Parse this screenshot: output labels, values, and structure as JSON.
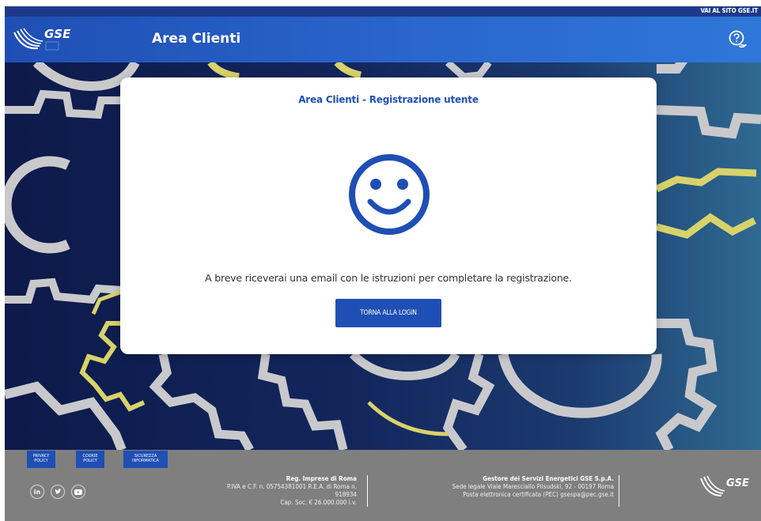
{
  "top_link": "VAI AL SITO GSE.IT",
  "header": {
    "logo_text": "GSE",
    "title": "Area Clienti"
  },
  "card": {
    "title": "Area Clienti - Registrazione utente",
    "message": "A breve riceverai una email con le istruzioni per completare la registrazione.",
    "button": "TORNA ALLA LOGIN"
  },
  "footer": {
    "links": [
      {
        "line1": "PRIVACY",
        "line2": "POLICY"
      },
      {
        "line1": "COOKIE",
        "line2": "POLICY"
      },
      {
        "line1": "SICUREZZA",
        "line2": "INFORMATICA"
      }
    ],
    "social": [
      "in",
      "t",
      "yt"
    ],
    "registry": {
      "heading": "Reg. Imprese di Roma",
      "line1": "P.IVA e C.F. n. 05754381001 R.E.A. di Roma n.",
      "line2": "918934",
      "line3": "Cap. Soc. € 26.000.000 i.v."
    },
    "company": {
      "heading": "Gestore dei Servizi Energetici GSE S.p.A.",
      "line1": "Sede legale Viale Maresciallo Pilsudski, 92 - 00197 Roma",
      "line2": "Posta elettronica certificata (PEC) gsespa@pec.gse.it"
    },
    "logo_text": "GSE"
  },
  "colors": {
    "brand_blue": "#1f4fb4",
    "hero_dark": "#0d1a4a",
    "gear_gray": "#c9c9cc",
    "gear_yellow": "#d8d26a",
    "footer_gray": "#7f7f7f"
  }
}
